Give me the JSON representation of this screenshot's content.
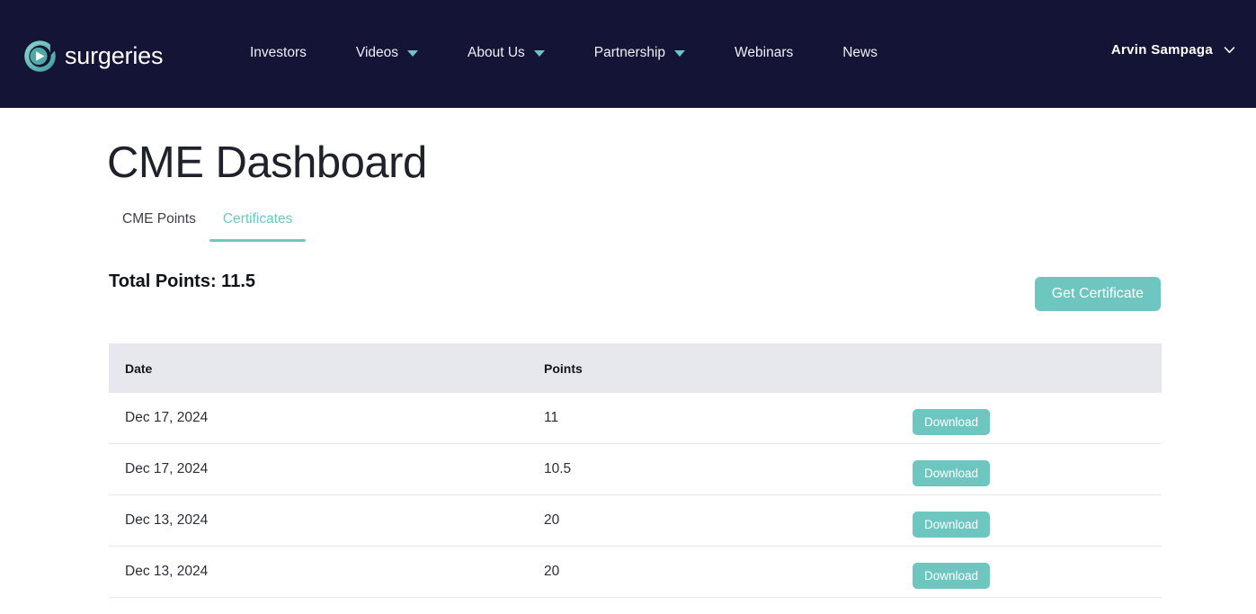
{
  "header": {
    "brand": {
      "name": "surgeries",
      "logo_icon": "play-circle-logo-icon",
      "logo_color": "#5fbfbb"
    },
    "background_color": "#131436",
    "nav_items": [
      {
        "label": "Investors",
        "has_dropdown": false
      },
      {
        "label": "Videos",
        "has_dropdown": true
      },
      {
        "label": "About Us",
        "has_dropdown": true
      },
      {
        "label": "Partnership",
        "has_dropdown": true
      },
      {
        "label": "Webinars",
        "has_dropdown": false
      },
      {
        "label": "News",
        "has_dropdown": false
      }
    ],
    "user": {
      "name": "Arvin Sampaga",
      "chevron_icon": "chevron-down-icon"
    }
  },
  "page": {
    "title": "CME Dashboard"
  },
  "tabs": [
    {
      "label": "CME Points",
      "active": false
    },
    {
      "label": "Certificates",
      "active": true
    }
  ],
  "summary": {
    "total_points_label": "Total Points: 11.5",
    "get_certificate_label": "Get Certificate"
  },
  "table": {
    "columns": [
      "Date",
      "Points",
      ""
    ],
    "header_background": "#e7e8ee",
    "action_label": "Download",
    "rows": [
      {
        "date": "Dec 17, 2024",
        "points": "11",
        "action": "Download"
      },
      {
        "date": "Dec 17, 2024",
        "points": "10.5",
        "action": "Download"
      },
      {
        "date": "Dec 13, 2024",
        "points": "20",
        "action": "Download"
      },
      {
        "date": "Dec 13, 2024",
        "points": "20",
        "action": "Download"
      }
    ]
  },
  "theme": {
    "accent": "#6ec6c1",
    "navy": "#131436"
  }
}
